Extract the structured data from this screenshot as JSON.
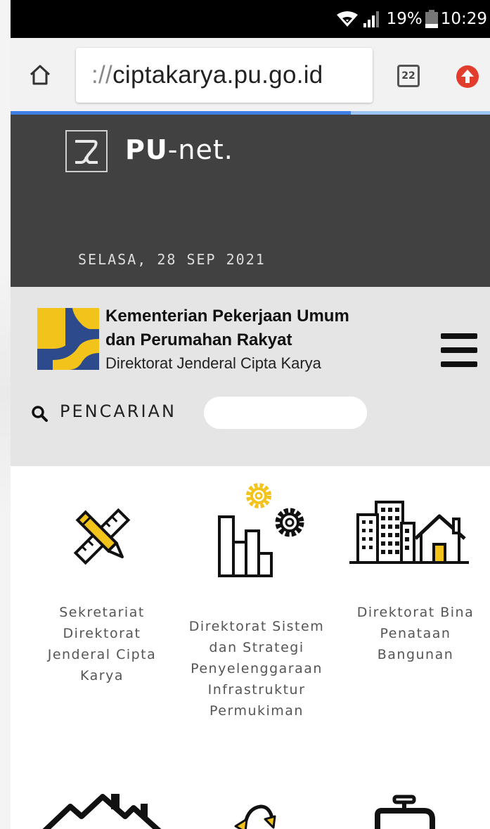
{
  "status_bar": {
    "battery": "19%",
    "time": "10:29"
  },
  "browser": {
    "url_scheme": "://",
    "url_host": "ciptakarya.pu.go.id",
    "tab_count": "22",
    "progress": 0.71
  },
  "hero": {
    "site_name_bold": "PU",
    "site_name_rest": "-net.",
    "date": "SELASA, 28 SEP 2021"
  },
  "header": {
    "ministry_line1": "Kementerian Pekerjaan Umum",
    "ministry_line2": "dan Perumahan Rakyat",
    "directorate": "Direktorat Jenderal Cipta Karya"
  },
  "search": {
    "label": "PENCARIAN",
    "placeholder": ""
  },
  "menu": [
    {
      "label_lines": [
        "Sekretariat",
        "Direktorat",
        "Jenderal Cipta",
        "Karya"
      ],
      "icon": "ruler-pencil-icon"
    },
    {
      "label_lines": [
        "Direktorat Sistem",
        "dan Strategi",
        "Penyelenggaraan",
        "Infrastruktur",
        "Permukiman"
      ],
      "icon": "chart-gears-icon"
    },
    {
      "label_lines": [
        "Direktorat Bina",
        "Penataan",
        "Bangunan"
      ],
      "icon": "buildings-house-icon"
    }
  ],
  "colors": {
    "accent_yellow": "#f2c31b",
    "ministry_blue": "#2d4a8c",
    "hero_bg": "#414141",
    "band_bg": "#e5e5e5"
  }
}
